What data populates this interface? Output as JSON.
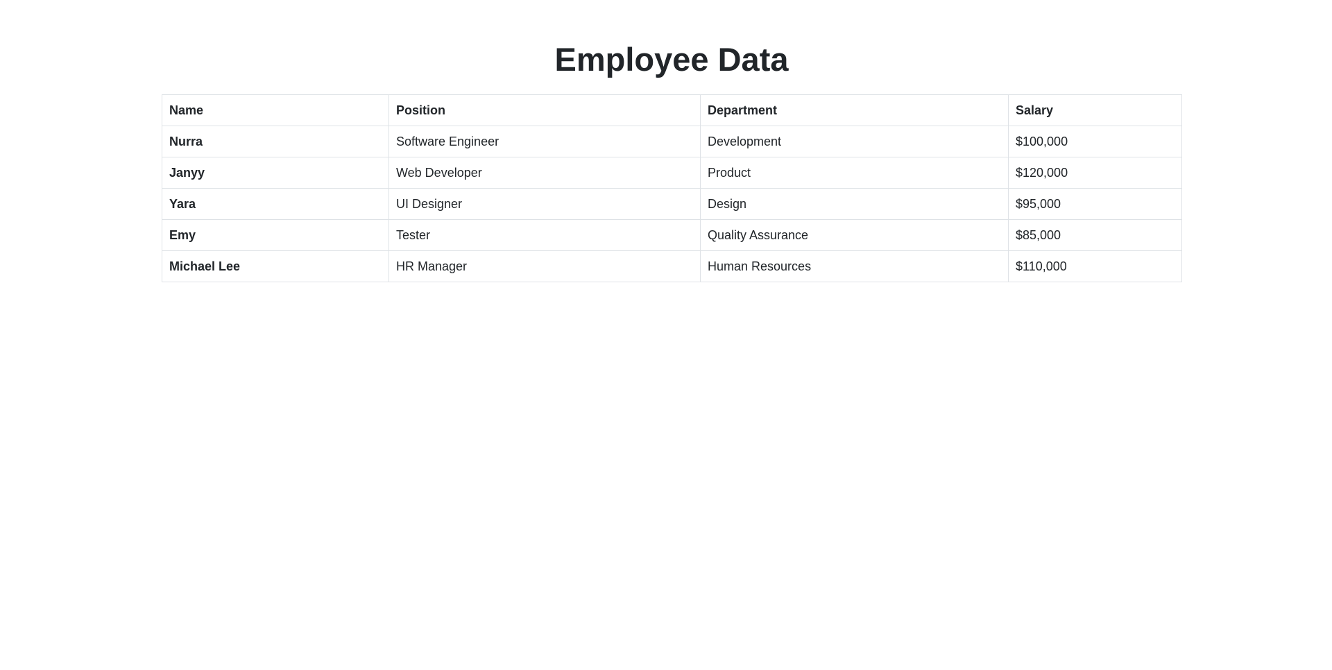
{
  "page": {
    "title": "Employee Data"
  },
  "table": {
    "headers": [
      "Name",
      "Position",
      "Department",
      "Salary"
    ],
    "rows": [
      {
        "name": "Nurra",
        "position": "Software Engineer",
        "department": "Development",
        "salary": "$100,000"
      },
      {
        "name": "Janyy",
        "position": "Web Developer",
        "department": "Product",
        "salary": "$120,000"
      },
      {
        "name": "Yara",
        "position": "UI Designer",
        "department": "Design",
        "salary": "$95,000"
      },
      {
        "name": "Emy",
        "position": "Tester",
        "department": "Quality Assurance",
        "salary": "$85,000"
      },
      {
        "name": "Michael Lee",
        "position": "HR Manager",
        "department": "Human Resources",
        "salary": "$110,000"
      }
    ]
  },
  "colors": {
    "text": "#212529",
    "border": "#dee2e6",
    "background": "#ffffff"
  }
}
